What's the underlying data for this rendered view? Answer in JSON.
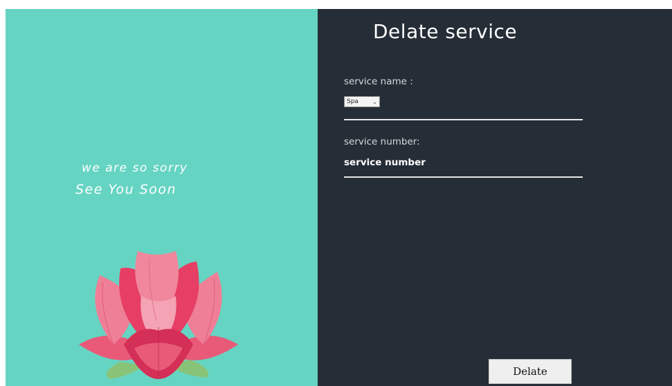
{
  "left": {
    "sorry_text": "we are so sorry",
    "soon_text": "See You Soon",
    "image_icon": "lotus-flower-icon"
  },
  "form": {
    "title": "Delate service",
    "service_name_label": "service name :",
    "service_name_selected": "Spa",
    "service_number_label": "service number:",
    "service_number_placeholder": "service number",
    "delete_button_label": "Delate"
  },
  "colors": {
    "left_background": "#66d4c2",
    "right_background": "#252d36",
    "petal_pink": "#e63e64",
    "leaf_green": "#8fbf6a"
  }
}
